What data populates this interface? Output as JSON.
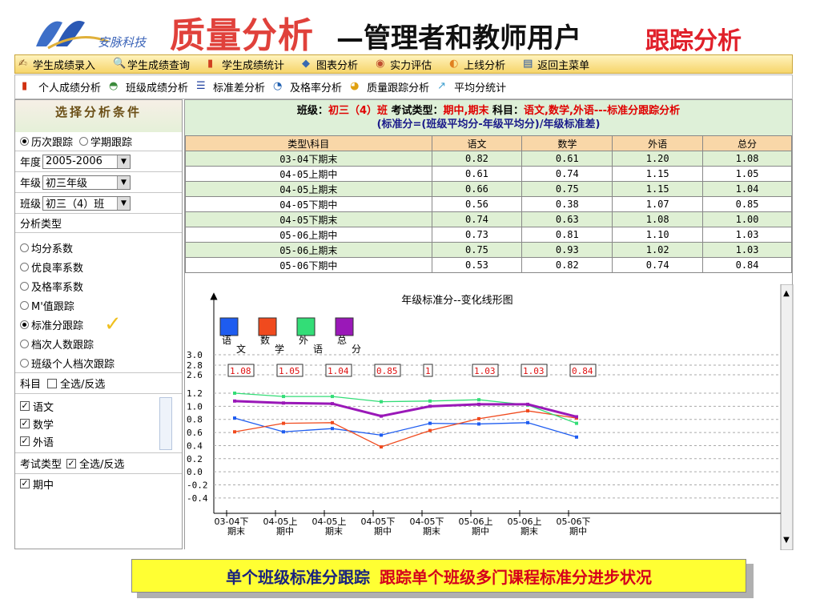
{
  "header": {
    "logo_text": "安脉科技",
    "title_main": "质量分析",
    "title_sub": "—管理者和教师用户",
    "title_tag": "跟踪分析"
  },
  "menu": [
    "学生成绩录入",
    "学生成绩查询",
    "学生成绩统计",
    "图表分析",
    "实力评估",
    "上线分析",
    "返回主菜单"
  ],
  "toolbar": [
    "个人成绩分析",
    "班级成绩分析",
    "标准差分析",
    "及格率分析",
    "质量跟踪分析",
    "平均分统计"
  ],
  "sidebar": {
    "heading": "选择分析条件",
    "track_options": [
      "历次跟踪",
      "学期跟踪"
    ],
    "year_label": "年度",
    "year_value": "2005-2006",
    "grade_label": "年级",
    "grade_value": "初三年级",
    "class_label": "班级",
    "class_value": "初三（4）班",
    "analysis_type_label": "分析类型",
    "analysis_types": [
      "均分系数",
      "优良率系数",
      "及格率系数",
      "M'值跟踪",
      "标准分跟踪",
      "档次人数跟踪",
      "班级个人档次跟踪"
    ],
    "selected_analysis": "标准分跟踪",
    "subject_label": "科目",
    "subject_all": "全选/反选",
    "subjects": [
      "语文",
      "数学",
      "外语"
    ],
    "exam_type_label": "考试类型",
    "exam_all": "全选/反选",
    "exam_types": [
      "期中"
    ]
  },
  "info": {
    "line1_a": "班级：",
    "line1_class": "初三（4）班",
    "line1_b": " 考试类型：",
    "line1_exam": "期中,期末",
    "line1_c": " 科目：",
    "line1_subj": "语文,数学,外语",
    "line1_d": "---标准分跟踪分析",
    "line2": "(标准分=(班级平均分-年级平均分)/年级标准差)"
  },
  "table": {
    "headers": [
      "类型\\科目",
      "语文",
      "数学",
      "外语",
      "总分"
    ],
    "rows": [
      [
        "03-04下期末",
        "0.82",
        "0.61",
        "1.20",
        "1.08"
      ],
      [
        "04-05上期中",
        "0.61",
        "0.74",
        "1.15",
        "1.05"
      ],
      [
        "04-05上期末",
        "0.66",
        "0.75",
        "1.15",
        "1.04"
      ],
      [
        "04-05下期中",
        "0.56",
        "0.38",
        "1.07",
        "0.85"
      ],
      [
        "04-05下期末",
        "0.74",
        "0.63",
        "1.08",
        "1.00"
      ],
      [
        "05-06上期中",
        "0.73",
        "0.81",
        "1.10",
        "1.03"
      ],
      [
        "05-06上期末",
        "0.75",
        "0.93",
        "1.02",
        "1.03"
      ],
      [
        "05-06下期中",
        "0.53",
        "0.82",
        "0.74",
        "0.84"
      ]
    ]
  },
  "chart_data": {
    "type": "line",
    "title": "年级标准分--变化线形图",
    "categories": [
      [
        "03-04下",
        "期末"
      ],
      [
        "04-05上",
        "期中"
      ],
      [
        "04-05上",
        "期末"
      ],
      [
        "04-05下",
        "期中"
      ],
      [
        "04-05下",
        "期末"
      ],
      [
        "05-06上",
        "期中"
      ],
      [
        "05-06上",
        "期末"
      ],
      [
        "05-06下",
        "期中"
      ]
    ],
    "series": [
      {
        "name": "语文",
        "color": "#1e5cf0",
        "values": [
          0.82,
          0.61,
          0.66,
          0.56,
          0.74,
          0.73,
          0.75,
          0.53
        ]
      },
      {
        "name": "数学",
        "color": "#f04a1e",
        "values": [
          0.61,
          0.74,
          0.75,
          0.38,
          0.63,
          0.81,
          0.93,
          0.82
        ]
      },
      {
        "name": "外语",
        "color": "#33dd77",
        "values": [
          1.2,
          1.15,
          1.15,
          1.07,
          1.08,
          1.1,
          1.02,
          0.74
        ]
      },
      {
        "name": "总分",
        "color": "#9a18b8",
        "values": [
          1.08,
          1.05,
          1.04,
          0.85,
          1.0,
          1.03,
          1.03,
          0.84
        ]
      }
    ],
    "total_labels": [
      "1.08",
      "1.05",
      "1.04",
      "0.85",
      "1",
      "1.03",
      "1.03",
      "0.84"
    ],
    "yticks": [
      "3.0",
      "2.8",
      "2.6",
      "1.2",
      "1.0",
      "0.8",
      "0.6",
      "0.4",
      "0.2",
      "0.0",
      "-0.2",
      "-0.4"
    ],
    "ylim": [
      -0.4,
      1.2
    ]
  },
  "footer": {
    "a": "单个班级标准分跟踪",
    "b": "跟踪单个班级多门课程标准分进步状况"
  }
}
